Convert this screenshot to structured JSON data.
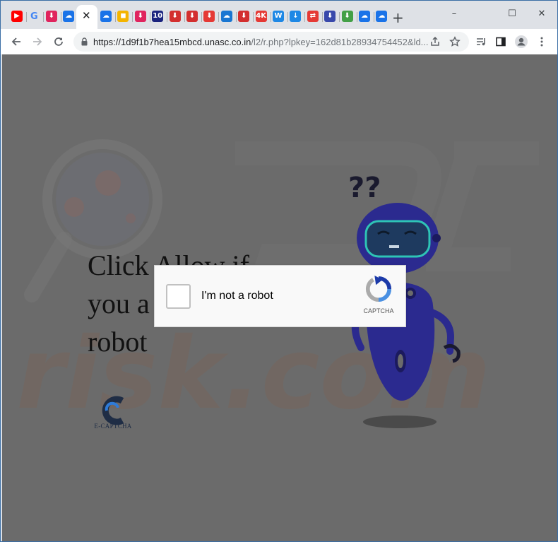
{
  "browser": {
    "url_host": "https://1d9f1b7hea15mbcd.unasc.co.in",
    "url_path": "/l2/r.php?lpkey=162d81b28934754452&ld...",
    "tabs": [
      {
        "icon": "youtube-icon",
        "color": "#ff0000",
        "glyph": "▶"
      },
      {
        "icon": "google-icon",
        "color": "#ffffff",
        "glyph": "G"
      },
      {
        "icon": "download-icon",
        "color": "#e0245e",
        "glyph": "⬇"
      },
      {
        "icon": "cloud-download-icon",
        "color": "#1a73e8",
        "glyph": "☁"
      },
      {
        "icon": "tab-close-icon",
        "color": "#202124",
        "glyph": "✕"
      },
      {
        "icon": "cloud-icon",
        "color": "#1a73e8",
        "glyph": "☁"
      },
      {
        "icon": "video-icon",
        "color": "#f4b400",
        "glyph": "◼"
      },
      {
        "icon": "download-icon",
        "color": "#e0245e",
        "glyph": "⬇"
      },
      {
        "icon": "ten-icon",
        "color": "#1a237e",
        "glyph": "10"
      },
      {
        "icon": "download-icon",
        "color": "#d32f2f",
        "glyph": "⬇"
      },
      {
        "icon": "download-icon",
        "color": "#d32f2f",
        "glyph": "⬇"
      },
      {
        "icon": "download-icon",
        "color": "#e53935",
        "glyph": "⬇"
      },
      {
        "icon": "cloud-icon",
        "color": "#1976d2",
        "glyph": "☁"
      },
      {
        "icon": "download-icon",
        "color": "#d32f2f",
        "glyph": "⬇"
      },
      {
        "icon": "4k-icon",
        "color": "#e53935",
        "glyph": "4K"
      },
      {
        "icon": "w-icon",
        "color": "#1e88e5",
        "glyph": "W"
      },
      {
        "icon": "arrow-down-icon",
        "color": "#1e88e5",
        "glyph": "↓"
      },
      {
        "icon": "convert-icon",
        "color": "#e53935",
        "glyph": "⇄"
      },
      {
        "icon": "download-icon",
        "color": "#3949ab",
        "glyph": "⬇"
      },
      {
        "icon": "download-icon",
        "color": "#43a047",
        "glyph": "⬇"
      },
      {
        "icon": "cloud-download-icon",
        "color": "#1a73e8",
        "glyph": "☁"
      },
      {
        "icon": "cloud-download-icon",
        "color": "#1a73e8",
        "glyph": "☁"
      }
    ],
    "new_tab": "+",
    "window_controls": {
      "minimize": "–",
      "maximize": "☐",
      "close": "✕"
    }
  },
  "page": {
    "headline_lines": [
      "Click Allow if",
      "you a",
      "robot"
    ],
    "ecaptcha_label": "E-CAPTCHA",
    "captcha": {
      "label": "I'm not a robot",
      "brand": "CAPTCHA"
    }
  },
  "colors": {
    "overlay": "#6b6b6b",
    "robot_body": "#2b2a8f",
    "robot_visor": "#1e3a5f",
    "robot_visor_edge": "#2ec4b6"
  }
}
